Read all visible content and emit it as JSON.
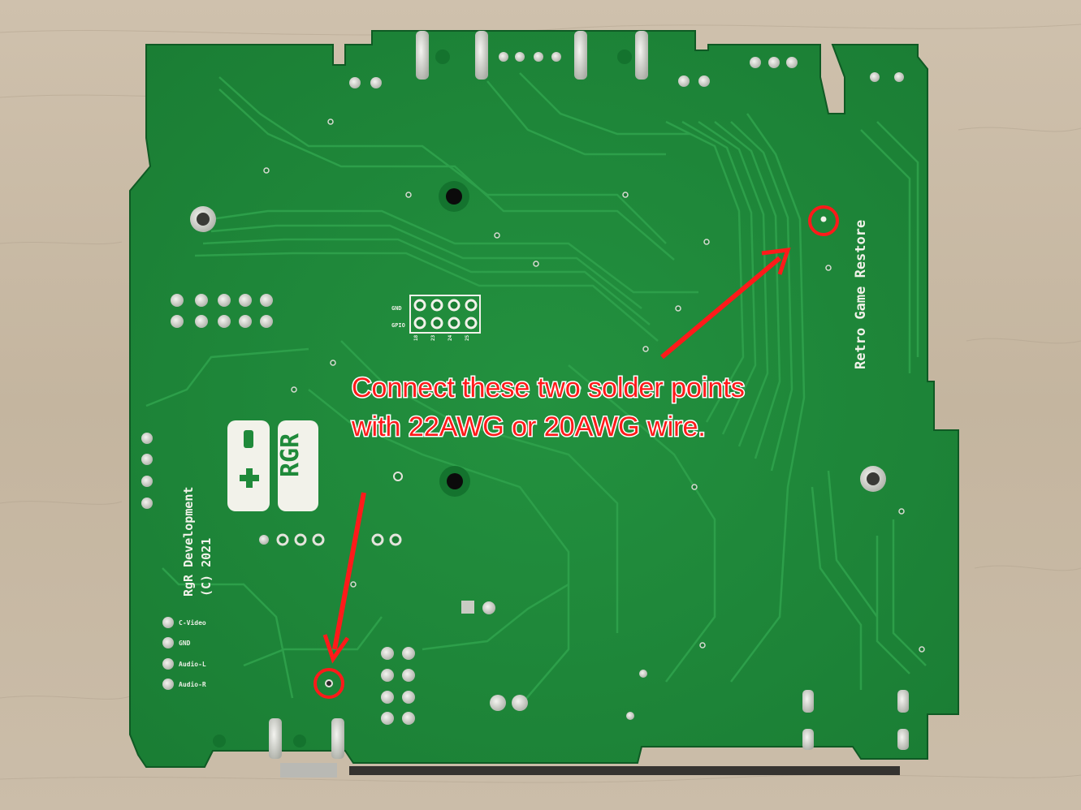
{
  "annotation": {
    "line1": "Connect these two solder points",
    "line2": "with 22AWG or 20AWG wire.",
    "color": "#ff1a1a"
  },
  "silkscreen": {
    "brand_right": "Retro Game Restore",
    "dev_line1": "RgR Development",
    "dev_line2": "(C) 2021",
    "logo_letters": "RGR",
    "header_labels": [
      "GND",
      "GPIO"
    ],
    "header_pins": [
      "18",
      "23",
      "24",
      "25"
    ],
    "av_labels": [
      "C-Video",
      "GND",
      "Audio-L",
      "Audio-R"
    ]
  },
  "colors": {
    "pcb": "#1f8a3a",
    "pcb_dark": "#157a30",
    "trace": "#2a9a45",
    "silk": "#f2f2ea",
    "wood": "#c9bba8"
  }
}
